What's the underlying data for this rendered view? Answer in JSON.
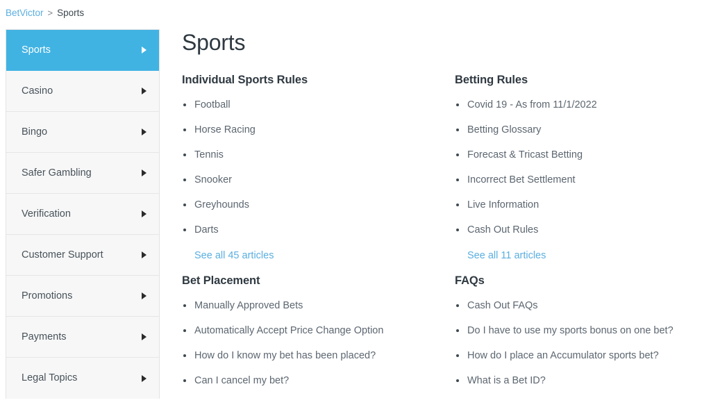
{
  "breadcrumb": {
    "root_label": "BetVictor",
    "separator": ">",
    "current_label": "Sports"
  },
  "sidebar": {
    "items": [
      {
        "label": "Sports",
        "icon": "caret-right-icon",
        "active": true
      },
      {
        "label": "Casino",
        "icon": "caret-right-icon",
        "active": false
      },
      {
        "label": "Bingo",
        "icon": "caret-right-icon",
        "active": false
      },
      {
        "label": "Safer Gambling",
        "icon": "caret-right-icon",
        "active": false
      },
      {
        "label": "Verification",
        "icon": "caret-right-icon",
        "active": false
      },
      {
        "label": "Customer Support",
        "icon": "caret-right-icon",
        "active": false
      },
      {
        "label": "Promotions",
        "icon": "caret-right-icon",
        "active": false
      },
      {
        "label": "Payments",
        "icon": "caret-right-icon",
        "active": false
      },
      {
        "label": "Legal Topics",
        "icon": "caret-right-icon",
        "active": false
      }
    ]
  },
  "main": {
    "title": "Sports",
    "categories": [
      {
        "title": "Individual Sports Rules",
        "articles": [
          "Football",
          "Horse Racing",
          "Tennis",
          "Snooker",
          "Greyhounds",
          "Darts"
        ],
        "see_all": "See all 45 articles"
      },
      {
        "title": "Betting Rules",
        "articles": [
          "Covid 19 - As from 11/1/2022",
          "Betting Glossary",
          "Forecast & Tricast Betting",
          "Incorrect Bet Settlement",
          "Live Information",
          "Cash Out Rules"
        ],
        "see_all": "See all 11 articles"
      },
      {
        "title": "Bet Placement",
        "articles": [
          "Manually Approved Bets",
          "Automatically Accept Price Change Option",
          "How do I know my bet has been placed?",
          "Can I cancel my bet?"
        ],
        "see_all": ""
      },
      {
        "title": "FAQs",
        "articles": [
          "Cash Out FAQs",
          "Do I have to use my sports bonus on one bet?",
          "How do I place an Accumulator sports bet?",
          "What is a Bet ID?"
        ],
        "see_all": ""
      }
    ]
  },
  "colors": {
    "accent_blue": "#41b3e3",
    "link_blue": "#5aaee0",
    "heading_dark": "#2f3941",
    "body_gray": "#5c6670",
    "sidebar_bg": "#f7f7f7"
  }
}
